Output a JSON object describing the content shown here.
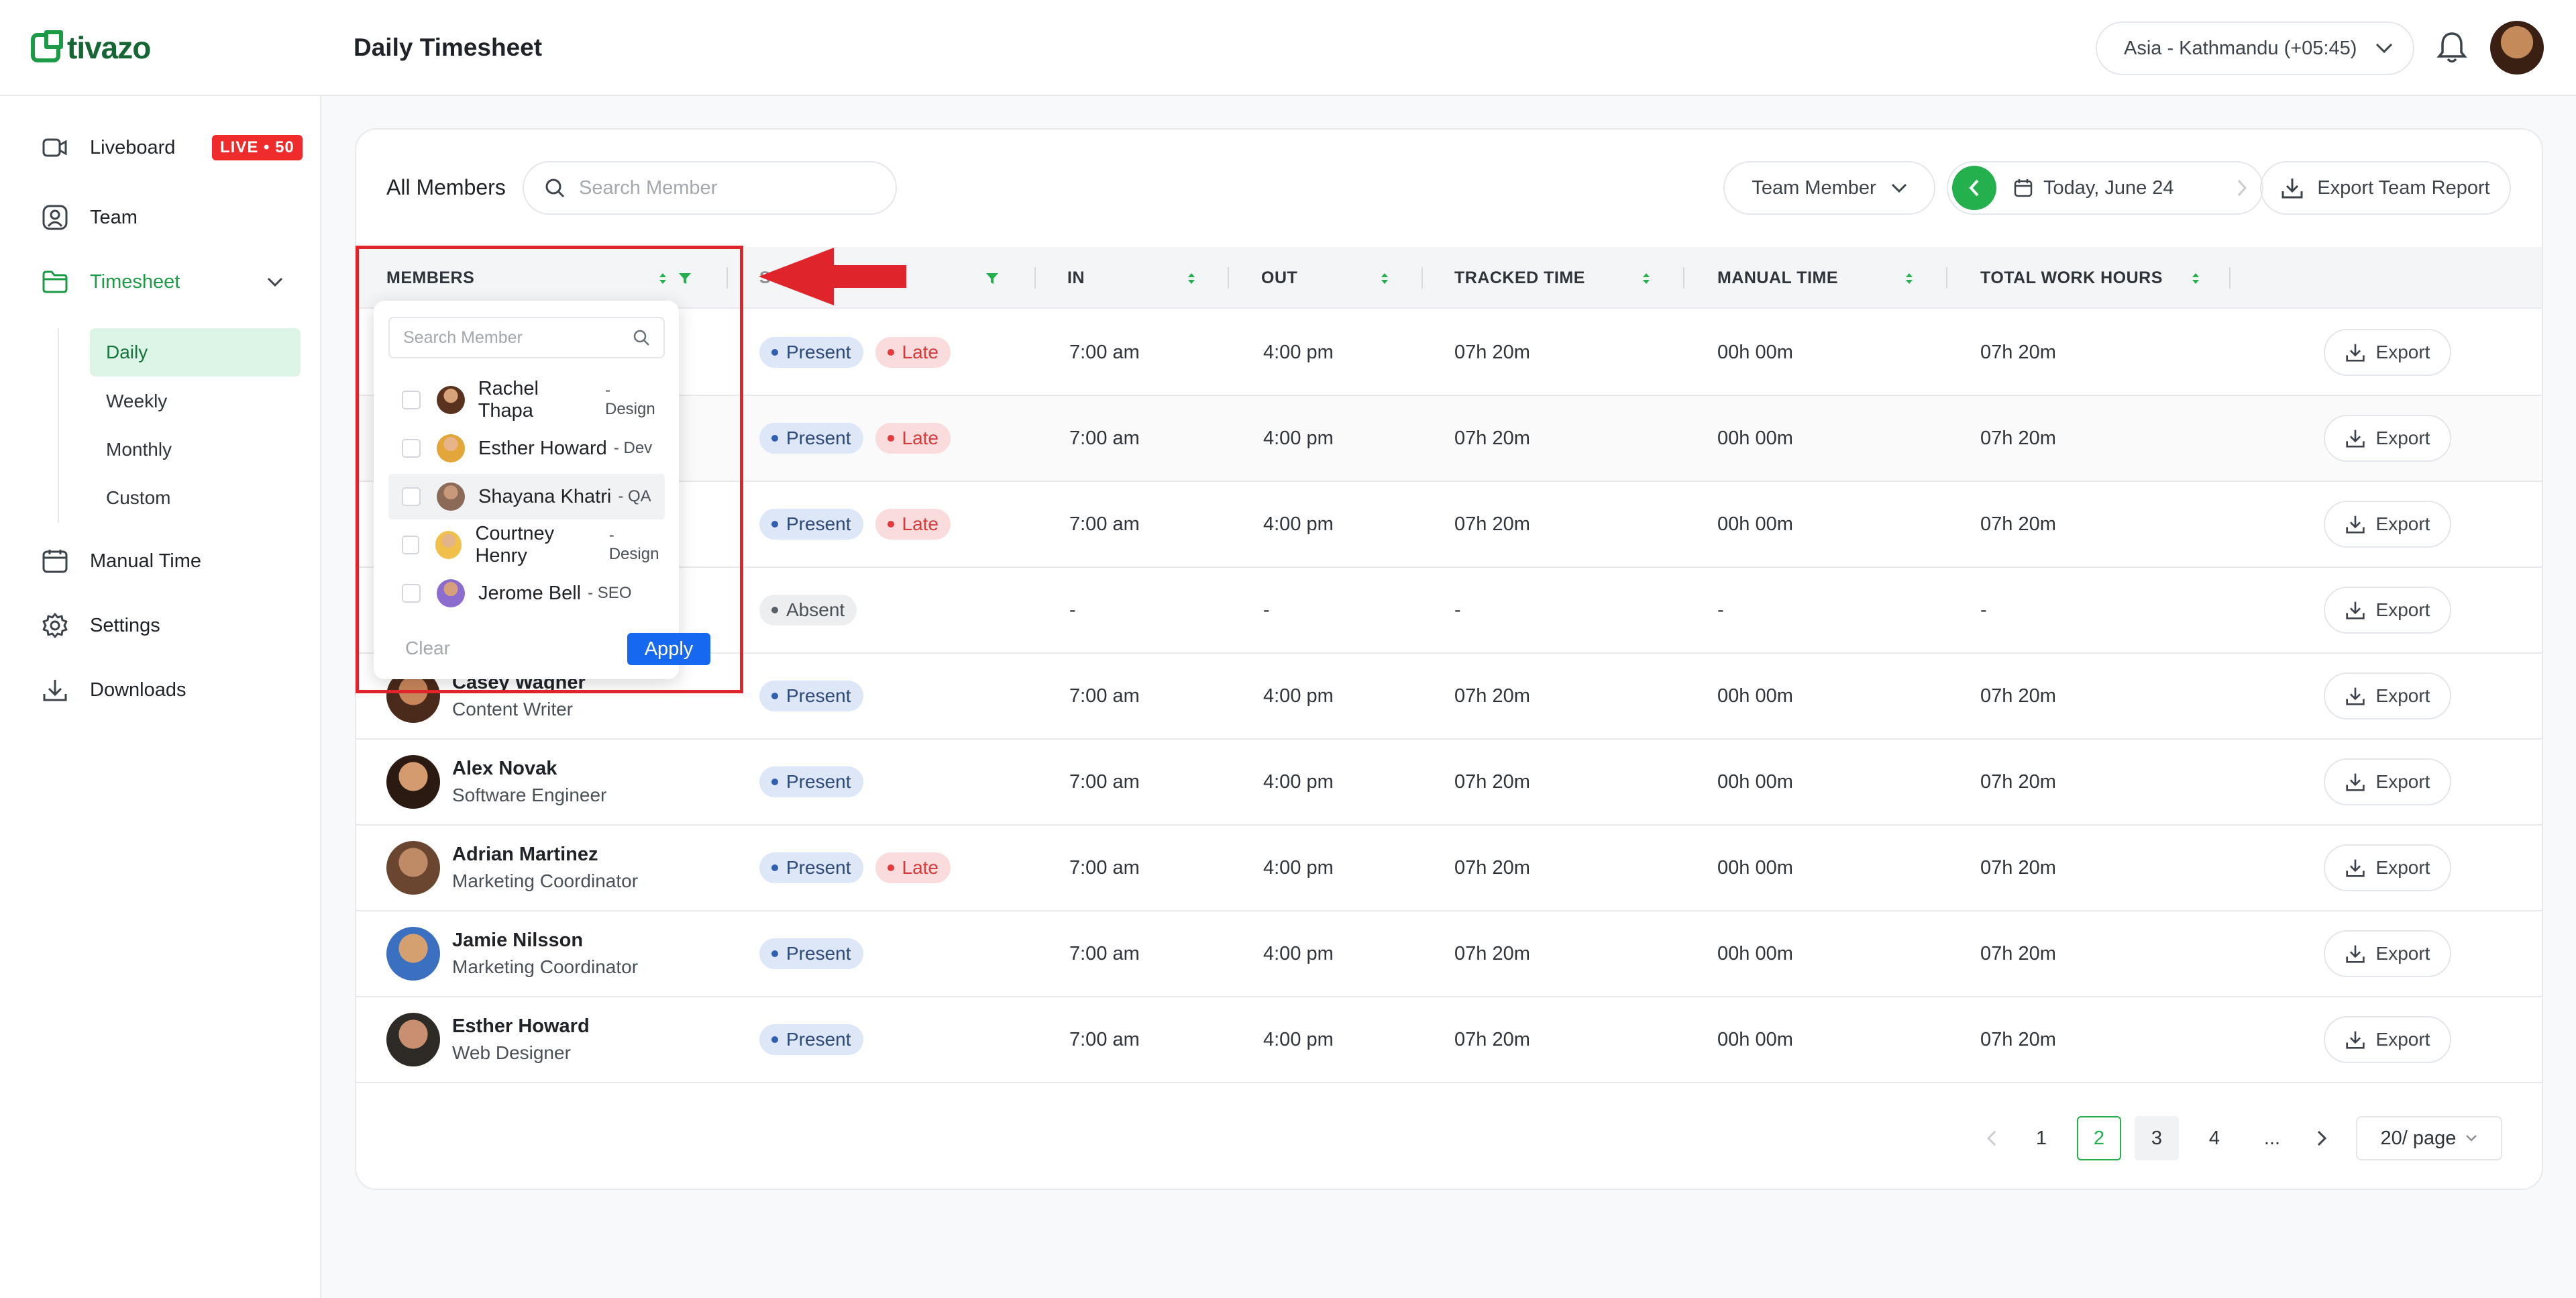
{
  "app": {
    "logo_text": "tivazo",
    "page_title": "Daily Timesheet"
  },
  "header": {
    "timezone": "Asia - Kathmandu (+05:45)"
  },
  "sidebar": {
    "items": [
      {
        "label": "Liveboard",
        "icon": "video-icon",
        "badge": "LIVE • 50"
      },
      {
        "label": "Team",
        "icon": "user-circle-icon"
      },
      {
        "label": "Timesheet",
        "icon": "folder-icon"
      },
      {
        "label": "Manual Time",
        "icon": "calendar-icon"
      },
      {
        "label": "Settings",
        "icon": "gear-icon"
      },
      {
        "label": "Downloads",
        "icon": "download-icon"
      }
    ],
    "timesheet_sub": [
      "Daily",
      "Weekly",
      "Monthly",
      "Custom"
    ]
  },
  "toolbar": {
    "title": "All Members",
    "search_placeholder": "Search Member",
    "team_select": "Team Member",
    "date_label": "Today, June 24",
    "export_team": "Export Team Report"
  },
  "table": {
    "columns": [
      "MEMBERS",
      "STATUS",
      "IN",
      "OUT",
      "TRACKED TIME",
      "MANUAL TIME",
      "TOTAL WORK HOURS"
    ],
    "export_label": "Export",
    "rows": [
      {
        "name": "",
        "role": "",
        "status": [
          "Present",
          "Late"
        ],
        "in": "7:00 am",
        "out": "4:00 pm",
        "tracked": "07h 20m",
        "manual": "00h 00m",
        "total": "07h 20m"
      },
      {
        "name": "",
        "role": "",
        "status": [
          "Present",
          "Late"
        ],
        "in": "7:00 am",
        "out": "4:00 pm",
        "tracked": "07h 20m",
        "manual": "00h 00m",
        "total": "07h 20m"
      },
      {
        "name": "",
        "role": "",
        "status": [
          "Present",
          "Late"
        ],
        "in": "7:00 am",
        "out": "4:00 pm",
        "tracked": "07h 20m",
        "manual": "00h 00m",
        "total": "07h 20m"
      },
      {
        "name": "",
        "role": "",
        "status": [
          "Absent"
        ],
        "in": "-",
        "out": "-",
        "tracked": "-",
        "manual": "-",
        "total": "-"
      },
      {
        "name": "Casey Wagner",
        "role": "Content Writer",
        "status": [
          "Present"
        ],
        "in": "7:00 am",
        "out": "4:00 pm",
        "tracked": "07h 20m",
        "manual": "00h 00m",
        "total": "07h 20m"
      },
      {
        "name": "Alex Novak",
        "role": "Software Engineer",
        "status": [
          "Present"
        ],
        "in": "7:00 am",
        "out": "4:00 pm",
        "tracked": "07h 20m",
        "manual": "00h 00m",
        "total": "07h 20m"
      },
      {
        "name": "Adrian Martinez",
        "role": "Marketing Coordinator",
        "status": [
          "Present",
          "Late"
        ],
        "in": "7:00 am",
        "out": "4:00 pm",
        "tracked": "07h 20m",
        "manual": "00h 00m",
        "total": "07h 20m"
      },
      {
        "name": "Jamie Nilsson",
        "role": "Marketing Coordinator",
        "status": [
          "Present"
        ],
        "in": "7:00 am",
        "out": "4:00 pm",
        "tracked": "07h 20m",
        "manual": "00h 00m",
        "total": "07h 20m"
      },
      {
        "name": "Esther Howard",
        "role": "Web Designer",
        "status": [
          "Present"
        ],
        "in": "7:00 am",
        "out": "4:00 pm",
        "tracked": "07h 20m",
        "manual": "00h 00m",
        "total": "07h 20m"
      }
    ]
  },
  "dropdown": {
    "search_placeholder": "Search Member",
    "members": [
      {
        "name": "Rachel Thapa",
        "role": "Design"
      },
      {
        "name": "Esther Howard",
        "role": "Dev"
      },
      {
        "name": "Shayana Khatri",
        "role": "QA"
      },
      {
        "name": "Courtney Henry",
        "role": "Design"
      },
      {
        "name": "Jerome Bell",
        "role": "SEO"
      }
    ],
    "clear": "Clear",
    "apply": "Apply"
  },
  "pagination": {
    "pages": [
      "1",
      "2",
      "3",
      "4",
      "..."
    ],
    "current": "2",
    "page_size": "20/ page"
  },
  "colors": {
    "brand": "#23b04d",
    "accent": "#1668f0",
    "annotation": "#e0242c",
    "live": "#ef2b2b"
  }
}
